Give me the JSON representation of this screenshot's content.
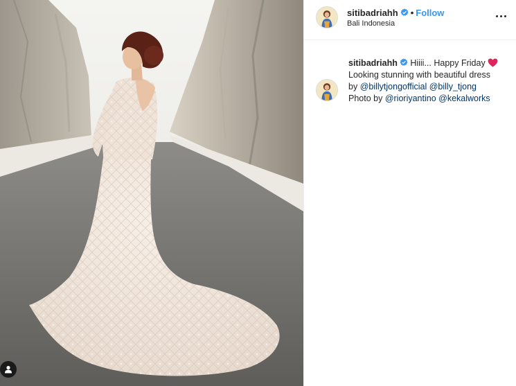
{
  "post": {
    "author": "sitibadriahh",
    "separator": "•",
    "follow_label": "Follow",
    "location": "Bali Indonesia"
  },
  "caption": {
    "username": "sitibadriahh",
    "line1": "Hiiii... Happy Friday",
    "line2": "Looking stunning with beautiful dress",
    "by": "by",
    "mention1": "@billytjongofficial",
    "mention2": "@billy_tjong",
    "photo_by": "Photo by",
    "mention3": "@rioriyantino",
    "mention4": "@kekalworks"
  },
  "icons": {
    "verified": "verified-badge-icon",
    "heart": "red-heart-emoji",
    "more": "more-options-icon",
    "user_tag": "user-tag-icon"
  },
  "colors": {
    "link_blue": "#3897f0",
    "mention": "#003569",
    "text": "#262626",
    "heart": "#ed4956"
  }
}
